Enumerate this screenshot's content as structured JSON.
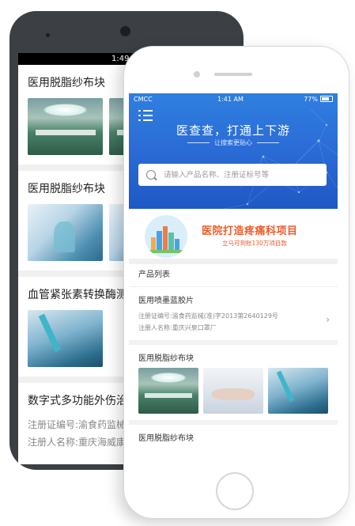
{
  "android": {
    "status_time": "1:49",
    "items": [
      {
        "title": "医用脱脂纱布块"
      },
      {
        "title": "医用脱脂纱布块"
      },
      {
        "title": "血管紧张素转换酶测"
      },
      {
        "title": "数字式多功能外伤治",
        "reg_no": "注册证编号:渝食药监械",
        "registrant": "注册人名称:重庆海威康"
      }
    ]
  },
  "iphone": {
    "status": {
      "carrier": "CMCC",
      "time": "1:41 AM",
      "battery": "77%"
    },
    "hero": {
      "title": "医查查，打通上下游",
      "subtitle": "让搜索更贴心"
    },
    "search": {
      "placeholder": "请输入产品名称、注册证标号等"
    },
    "banner": {
      "title": "医院打造疼痛科项目",
      "subtitle": "立马可到账130万项目款"
    },
    "section_title": "产品列表",
    "products": [
      {
        "title": "医用喷墨蓝胶片",
        "reg_no": "注册证编号:渝食药监械(准)字2013第2640129号",
        "registrant": "注册人名称:重庆兴泉口罩厂"
      },
      {
        "title": "医用脱脂纱布块"
      },
      {
        "title": "医用脱脂纱布块"
      }
    ]
  },
  "colors": {
    "accent_blue": "#2a69d4",
    "banner_orange": "#ee5a2a"
  },
  "icons": [
    "menu-icon",
    "search-icon",
    "chevron-right-icon",
    "wifi-icon",
    "battery-icon"
  ]
}
